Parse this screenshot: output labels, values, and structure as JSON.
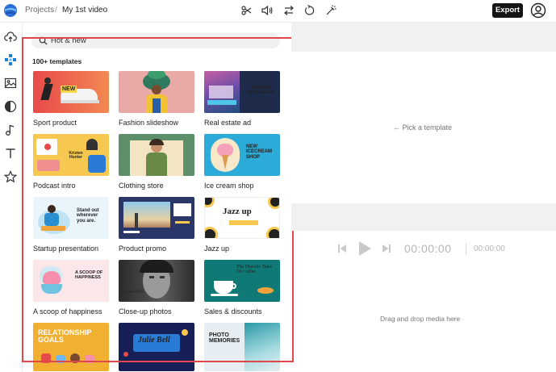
{
  "header": {
    "breadcrumb_root": "Projects",
    "breadcrumb_separator": "/",
    "project_name": "My 1st video",
    "export_label": "Export",
    "tool_icons": [
      "scissors-icon",
      "volume-icon",
      "swap-icon",
      "rotate-icon",
      "magic-wand-icon"
    ]
  },
  "sidebar": {
    "items": [
      "upload-icon",
      "templates-icon",
      "media-icon",
      "transitions-icon",
      "music-icon",
      "text-icon",
      "favorites-icon"
    ]
  },
  "templates": {
    "search_placeholder": "Hot & new",
    "count_label": "100+ templates",
    "items": [
      {
        "label": "Sport product",
        "thumb": {
          "bg": "#e4524a",
          "text": "NEW",
          "text_color": "#f5d44a"
        }
      },
      {
        "label": "Fashion slideshow",
        "thumb": {
          "bg": "#e8a7a4",
          "text": "",
          "text_color": "#ffffff"
        }
      },
      {
        "label": "Real estate ad",
        "thumb": {
          "bg": "#1e2b4a",
          "text": "MODERN PENTHOUSE",
          "text_color": "#ffffff"
        }
      },
      {
        "label": "Podcast intro",
        "thumb": {
          "bg": "#f6c84f",
          "text": "Kristen Hunter",
          "text_color": "#1f1f1f"
        }
      },
      {
        "label": "Clothing store",
        "thumb": {
          "bg": "#4a7b5a",
          "text": "",
          "text_color": "#ffffff"
        }
      },
      {
        "label": "Ice cream shop",
        "thumb": {
          "bg": "#2dabd8",
          "text": "NEW ICECREAM SHOP",
          "text_color": "#ffffff"
        }
      },
      {
        "label": "Startup presentation",
        "thumb": {
          "bg": "#e9f5fa",
          "text": "Stand out wherever you are.",
          "text_color": "#1a7fb5"
        }
      },
      {
        "label": "Product promo",
        "thumb": {
          "bg": "#2a3568",
          "text": "",
          "text_color": "#ffffff"
        }
      },
      {
        "label": "Jazz up",
        "thumb": {
          "bg": "#ffffff",
          "text": "Jazz up",
          "text_color": "#1f2a6b"
        }
      },
      {
        "label": "A scoop of happiness",
        "thumb": {
          "bg": "#fbe6ea",
          "text": "A SCOOP OF HAPPINESS",
          "text_color": "#e0577a"
        }
      },
      {
        "label": "Close-up photos",
        "thumb": {
          "bg": "#3a3a3a",
          "text": "CLOSE-UPS",
          "text_color": "#dddddd"
        }
      },
      {
        "label": "Sales & discounts",
        "thumb": {
          "bg": "#0f7a75",
          "text": "The Historic Tales Of Coffee",
          "text_color": "#ffffff"
        }
      },
      {
        "label": "",
        "thumb": {
          "bg": "#f2b033",
          "text": "RELATIONSHIP GOALS",
          "text_color": "#ffffff"
        }
      },
      {
        "label": "",
        "thumb": {
          "bg": "#172056",
          "text": "Julie Bell",
          "text_color": "#ffffff"
        }
      },
      {
        "label": "",
        "thumb": {
          "bg": "#e7eef3",
          "text": "PHOTO MEMORIES",
          "text_color": "#1f3b5c"
        }
      }
    ]
  },
  "preview": {
    "pick_hint": "← Pick a template",
    "current_time": "00:00:00",
    "total_time": "00:00:00",
    "drop_hint": "Drag and drop media here"
  },
  "colors": {
    "highlight_frame": "#e0474c",
    "export_button_bg": "#151515"
  }
}
